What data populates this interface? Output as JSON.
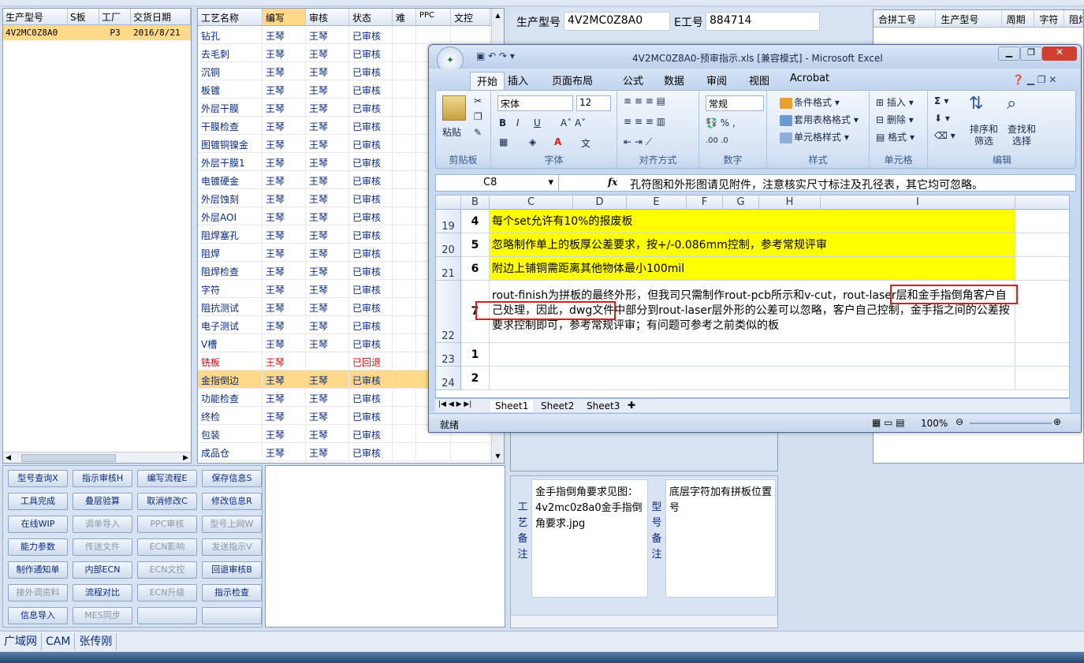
{
  "left_panel": {
    "headers": [
      "生产型号",
      "S板",
      "工厂",
      "交货日期"
    ],
    "row": [
      "4V2MC0Z8A0",
      "",
      "P3",
      "2016/8/21"
    ]
  },
  "process_table": {
    "headers": [
      "工艺名称",
      "编写",
      "审核",
      "状态",
      "难",
      "PPC",
      "文控"
    ],
    "rows": [
      [
        "钻孔",
        "王琴",
        "王琴",
        "已审核"
      ],
      [
        "去毛刺",
        "王琴",
        "王琴",
        "已审核"
      ],
      [
        "沉铜",
        "王琴",
        "王琴",
        "已审核"
      ],
      [
        "板镀",
        "王琴",
        "王琴",
        "已审核"
      ],
      [
        "外层干膜",
        "王琴",
        "王琴",
        "已审核"
      ],
      [
        "干膜检查",
        "王琴",
        "王琴",
        "已审核"
      ],
      [
        "图镀铜镍金",
        "王琴",
        "王琴",
        "已审核"
      ],
      [
        "外层干膜1",
        "王琴",
        "王琴",
        "已审核"
      ],
      [
        "电镀硬金",
        "王琴",
        "王琴",
        "已审核"
      ],
      [
        "外层蚀刻",
        "王琴",
        "王琴",
        "已审核"
      ],
      [
        "外层AOI",
        "王琴",
        "王琴",
        "已审核"
      ],
      [
        "阻焊塞孔",
        "王琴",
        "王琴",
        "已审核"
      ],
      [
        "阻焊",
        "王琴",
        "王琴",
        "已审核"
      ],
      [
        "阻焊检查",
        "王琴",
        "王琴",
        "已审核"
      ],
      [
        "字符",
        "王琴",
        "王琴",
        "已审核"
      ],
      [
        "阻抗测试",
        "王琴",
        "王琴",
        "已审核"
      ],
      [
        "电子测试",
        "王琴",
        "王琴",
        "已审核"
      ],
      [
        "V槽",
        "王琴",
        "王琴",
        "已审核"
      ],
      [
        "铣板",
        "王琴",
        "",
        "已回退"
      ],
      [
        "金指倒边",
        "王琴",
        "王琴",
        "已审核"
      ],
      [
        "功能检查",
        "王琴",
        "王琴",
        "已审核"
      ],
      [
        "终检",
        "王琴",
        "王琴",
        "已审核"
      ],
      [
        "包装",
        "王琴",
        "王琴",
        "已审核"
      ],
      [
        "成品仓",
        "王琴",
        "王琴",
        "已审核"
      ]
    ]
  },
  "buttons": [
    [
      "型号查询X",
      "指示审核H",
      "编写流程E",
      "保存信息S"
    ],
    [
      "工具完成",
      "叠层验算",
      "取消修改C",
      "修改信息R"
    ],
    [
      "在线WIP",
      "调单导入",
      "PPC审核",
      "型号上网W"
    ],
    [
      "能力参数",
      "传送文件",
      "ECN影响",
      "发送指示V"
    ],
    [
      "制作通知单",
      "内部ECN",
      "ECN文控",
      "回退审核B"
    ],
    [
      "接外调资料",
      "流程对比",
      "ECN升级",
      "指示检查"
    ],
    [
      "信息导入",
      "MES同步",
      "",
      ""
    ]
  ],
  "info": {
    "model_label": "生产型号",
    "model_value": "4V2MC0Z8A0",
    "eno_label": "E工号",
    "eno_value": "884714"
  },
  "right_grid": {
    "headers": [
      "合拼工号",
      "生产型号",
      "周期",
      "字符",
      "阻焊"
    ]
  },
  "notes": {
    "process_label": "工艺备注",
    "process_text": "金手指倒角要求见图：4v2mc0z8a0金手指倒角要求.jpg",
    "model_label": "型号备注",
    "model_text": "底层字符加有拼板位置号"
  },
  "statusbar": [
    "广域网",
    "CAM",
    "张传刚"
  ],
  "excel": {
    "title": "4V2MC0Z8A0-预审指示.xls  [兼容模式] - Microsoft Excel",
    "tabs": [
      "开始",
      "插入",
      "页面布局",
      "公式",
      "数据",
      "审阅",
      "视图",
      "Acrobat"
    ],
    "ribbon": {
      "paste": "粘贴",
      "font": "宋体",
      "size": "12",
      "number_format": "常规",
      "cond_format": "条件格式",
      "table_format": "套用表格格式",
      "cell_style": "单元格样式",
      "insert": "插入",
      "delete": "删除",
      "format": "格式",
      "sort": "排序和筛选",
      "find": "查找和选择",
      "groups": [
        "剪贴板",
        "字体",
        "对齐方式",
        "数字",
        "样式",
        "单元格",
        "编辑"
      ]
    },
    "name_box": "C8",
    "formula": "孔符图和外形图请见附件，注意核实尺寸标注及孔径表，其它均可忽略。",
    "columns": [
      "B",
      "C",
      "D",
      "E",
      "F",
      "G",
      "H",
      "I"
    ],
    "rows": [
      {
        "num": "19",
        "b": "4",
        "c": "每个set允许有10%的报废板"
      },
      {
        "num": "20",
        "b": "5",
        "c": "忽略制作单上的板厚公差要求，按+/-0.086mm控制，参考常规评审"
      },
      {
        "num": "21",
        "b": "6",
        "c": "附边上铺铜需距离其他物体最小100mil"
      },
      {
        "num": "22",
        "b": "7",
        "c": "rout-finish为拼板的最终外形，但我司只需制作rout-pcb所示和v-cut，rout-laser层和金手指倒角客户自己处理，因此，dwg文件中部分到rout-laser层外形的公差可以忽略，客户自己控制，金手指之间的公差按要求控制即可，参考常规评审；有问题可参考之前类似的板"
      },
      {
        "num": "23",
        "b": "1",
        "c": ""
      },
      {
        "num": "24",
        "b": "2",
        "c": ""
      }
    ],
    "sheets": [
      "Sheet1",
      "Sheet2",
      "Sheet3"
    ],
    "status": "就绪",
    "zoom": "100%"
  }
}
